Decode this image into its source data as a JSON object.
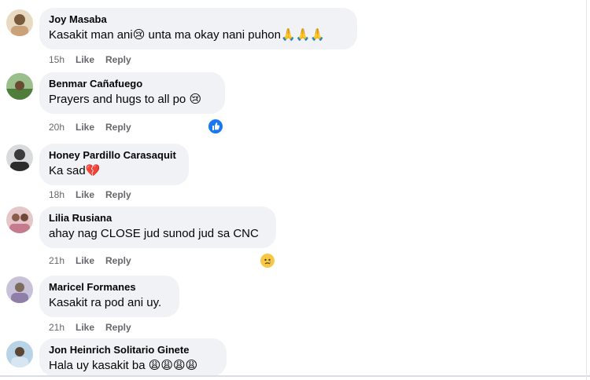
{
  "comments": [
    {
      "author": "Joy Masaba",
      "text": "Kasakit man ani😢 unta ma okay nani puhon🙏🙏🙏",
      "time": "15h",
      "like": "Like",
      "reply": "Reply",
      "reaction": ""
    },
    {
      "author": "Benmar Cañafuego",
      "text": "Prayers and hugs to all po 😢",
      "time": "20h",
      "like": "Like",
      "reply": "Reply",
      "reaction": "like-icon"
    },
    {
      "author": "Honey Pardillo Carasaquit",
      "text": "Ka sad💔",
      "time": "18h",
      "like": "Like",
      "reply": "Reply",
      "reaction": ""
    },
    {
      "author": "Lilia Rusiana",
      "text": "ahay nag CLOSE jud sunod jud sa CNC",
      "time": "21h",
      "like": "Like",
      "reply": "Reply",
      "reaction": "sad-icon"
    },
    {
      "author": "Maricel Formanes",
      "text": "Kasakit ra pod ani uy.",
      "time": "21h",
      "like": "Like",
      "reply": "Reply",
      "reaction": ""
    },
    {
      "author": "Jon Heinrich Solitario Ginete",
      "text": "Hala uy kasakit ba 😩😩😩😩",
      "time": "",
      "like": "",
      "reply": "",
      "reaction": ""
    }
  ],
  "colors": {
    "bubble": "#f0f2f5",
    "meta_text": "#65676b",
    "like_reaction": "#1877f2"
  }
}
